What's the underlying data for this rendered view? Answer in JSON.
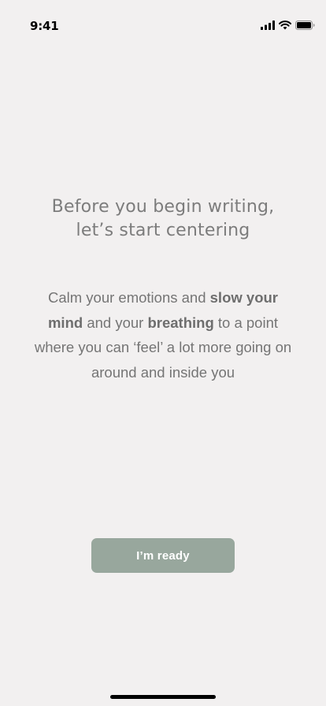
{
  "status_bar": {
    "time": "9:41",
    "icons": [
      "signal-icon",
      "wifi-icon",
      "battery-icon"
    ]
  },
  "heading": {
    "line1": "Before you begin writing,",
    "line2": "let’s start centering"
  },
  "body": {
    "segments": [
      {
        "text": "Calm your emotions and ",
        "bold": false
      },
      {
        "text": "slow your mind",
        "bold": true
      },
      {
        "text": " and your ",
        "bold": false
      },
      {
        "text": "breathing",
        "bold": true
      },
      {
        "text": " to a point where you can ‘feel’ a lot more going on around and inside you",
        "bold": false
      }
    ]
  },
  "button": {
    "label": "I’m ready",
    "color": "#98a79d"
  },
  "colors": {
    "background": "#f2f0f0",
    "text": "#7c7c7c"
  }
}
